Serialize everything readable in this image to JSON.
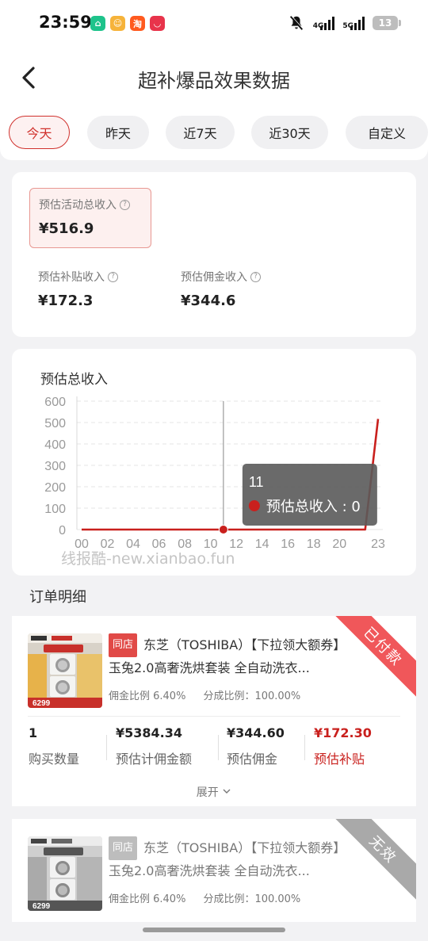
{
  "status_bar": {
    "time": "23:59",
    "network_a": "4G",
    "network_b": "5G",
    "battery": "13"
  },
  "header": {
    "title": "超补爆品效果数据"
  },
  "date_tabs": [
    {
      "label": "今天",
      "active": true
    },
    {
      "label": "昨天",
      "active": false
    },
    {
      "label": "近7天",
      "active": false
    },
    {
      "label": "近30天",
      "active": false
    },
    {
      "label": "自定义",
      "active": false
    }
  ],
  "summary": {
    "total_label": "预估活动总收入",
    "total_value": "¥516.9",
    "subsidy_label": "预估补贴收入",
    "subsidy_value": "¥172.3",
    "commission_label": "预估佣金收入",
    "commission_value": "¥344.6"
  },
  "chart": {
    "watermark": "线报酷-new.xianbao.fun"
  },
  "chart_data": {
    "type": "line",
    "title": "预估总收入",
    "x": [
      "00",
      "01",
      "02",
      "03",
      "04",
      "05",
      "06",
      "07",
      "08",
      "09",
      "10",
      "11",
      "12",
      "13",
      "14",
      "15",
      "16",
      "17",
      "18",
      "19",
      "20",
      "21",
      "22",
      "23"
    ],
    "x_tick_labels": [
      "00",
      "02",
      "04",
      "06",
      "08",
      "10",
      "12",
      "14",
      "16",
      "18",
      "20",
      "23"
    ],
    "series": [
      {
        "name": "预估总收入",
        "color": "#c9201d",
        "values": [
          0,
          0,
          0,
          0,
          0,
          0,
          0,
          0,
          0,
          0,
          0,
          0,
          0,
          0,
          0,
          0,
          0,
          0,
          0,
          0,
          0,
          0,
          0,
          516.9
        ]
      }
    ],
    "ylim": [
      0,
      600
    ],
    "y_ticks": [
      0,
      100,
      200,
      300,
      400,
      500,
      600
    ],
    "grid": true,
    "tooltip": {
      "x": "11",
      "label": "预估总收入",
      "value": "0"
    }
  },
  "orders_section": {
    "title": "订单明细"
  },
  "orders": [
    {
      "store_tag": "同店",
      "title": "东芝（TOSHIBA）【下拉领大额券】玉兔2.0高奢洗烘套装 全自动洗衣...",
      "commission_ratio": "佣金比例 6.40%",
      "share_ratio": "分成比例：100.00%",
      "status": "已付款",
      "status_color": "#f0575a",
      "thumb_price": "6299",
      "stats": [
        {
          "value": "1",
          "label": "购买数量"
        },
        {
          "value": "¥5384.34",
          "label": "预估计佣金额"
        },
        {
          "value": "¥344.60",
          "label": "预估佣金"
        },
        {
          "value": "¥172.30",
          "label": "预估补贴"
        }
      ],
      "expand_label": "展开"
    },
    {
      "store_tag": "同店",
      "title": "东芝（TOSHIBA）【下拉领大额券】玉兔2.0高奢洗烘套装 全自动洗衣...",
      "commission_ratio": "佣金比例 6.40%",
      "share_ratio": "分成比例：100.00%",
      "status": "无效",
      "status_color": "#a9a9a9",
      "thumb_price": "6299"
    }
  ]
}
